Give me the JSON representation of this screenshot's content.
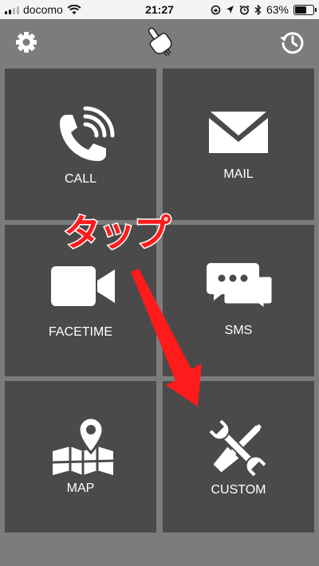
{
  "status_bar": {
    "carrier": "docomo",
    "time": "21:27",
    "battery": "63%",
    "battery_level": 0.63,
    "icons": [
      "signal-icon",
      "wifi-icon",
      "orientation-lock-icon",
      "location-icon",
      "alarm-icon",
      "bluetooth-icon",
      "battery-icon"
    ]
  },
  "toolbar": {
    "left_icon": "gear-icon",
    "center_icon": "hand-touch-icon",
    "right_icon": "history-icon"
  },
  "tiles": {
    "call": {
      "label": "CALL",
      "icon": "phone-icon"
    },
    "mail": {
      "label": "MAIL",
      "icon": "envelope-icon"
    },
    "facetime": {
      "label": "FACETIME",
      "icon": "video-camera-icon"
    },
    "sms": {
      "label": "SMS",
      "icon": "chat-bubbles-icon"
    },
    "map": {
      "label": "MAP",
      "icon": "map-pin-icon"
    },
    "custom": {
      "label": "CUSTOM",
      "icon": "wrench-screwdriver-icon"
    }
  },
  "annotation": {
    "text": "タップ",
    "color": "#ff1b1b",
    "icon": "arrow-icon"
  },
  "colors": {
    "background": "#7c7c7c",
    "tile": "#4a4a4a",
    "statusbar": "#f4f4f4",
    "icon": "#ffffff"
  }
}
